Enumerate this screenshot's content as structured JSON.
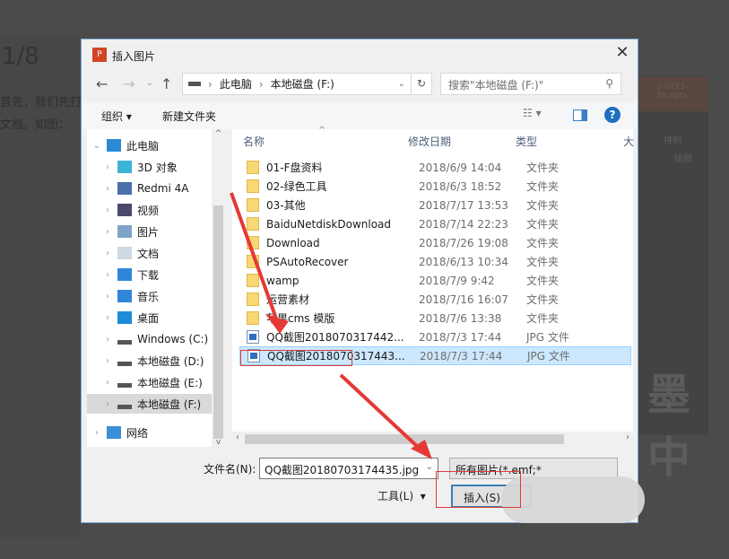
{
  "background": {
    "page_counter": "1/8",
    "line1": "首先，我们先打",
    "line2": "文档。如图：",
    "file_label": "3-0723-20.pptx",
    "ribbon_label1": "排列",
    "ribbon_label2": "绘图",
    "big_text": "墨中"
  },
  "dialog": {
    "title": "插入图片",
    "app_icon": "powerpoint-icon",
    "address": {
      "root": "此电脑",
      "current": "本地磁盘 (F:)"
    },
    "search_placeholder": "搜索\"本地磁盘 (F:)\"",
    "toolbar": {
      "organize": "组织 ▾",
      "new_folder": "新建文件夹"
    },
    "sidebar": [
      {
        "label": "此电脑",
        "icon": "computer-icon",
        "expanded": true
      },
      {
        "label": "3D 对象",
        "icon": "cube-icon"
      },
      {
        "label": "Redmi 4A",
        "icon": "phone-icon"
      },
      {
        "label": "视频",
        "icon": "video-icon"
      },
      {
        "label": "图片",
        "icon": "pictures-icon"
      },
      {
        "label": "文档",
        "icon": "document-icon"
      },
      {
        "label": "下载",
        "icon": "download-icon"
      },
      {
        "label": "音乐",
        "icon": "music-icon"
      },
      {
        "label": "桌面",
        "icon": "desktop-icon"
      },
      {
        "label": "Windows (C:)",
        "icon": "drive-icon"
      },
      {
        "label": "本地磁盘 (D:)",
        "icon": "drive-icon"
      },
      {
        "label": "本地磁盘 (E:)",
        "icon": "drive-icon"
      },
      {
        "label": "本地磁盘 (F:)",
        "icon": "drive-icon",
        "selected": true
      },
      {
        "label": "网络",
        "icon": "network-icon"
      }
    ],
    "columns": [
      "名称",
      "修改日期",
      "类型",
      "大"
    ],
    "files": [
      {
        "name": "01-F盘资料",
        "date": "2018/6/9 14:04",
        "type": "文件夹",
        "kind": "folder"
      },
      {
        "name": "02-绿色工具",
        "date": "2018/6/3 18:52",
        "type": "文件夹",
        "kind": "folder"
      },
      {
        "name": "03-其他",
        "date": "2018/7/17 13:53",
        "type": "文件夹",
        "kind": "folder"
      },
      {
        "name": "BaiduNetdiskDownload",
        "date": "2018/7/14 22:23",
        "type": "文件夹",
        "kind": "folder"
      },
      {
        "name": "Download",
        "date": "2018/7/26 19:08",
        "type": "文件夹",
        "kind": "folder"
      },
      {
        "name": "PSAutoRecover",
        "date": "2018/6/13 10:34",
        "type": "文件夹",
        "kind": "folder"
      },
      {
        "name": "wamp",
        "date": "2018/7/9 9:42",
        "type": "文件夹",
        "kind": "folder"
      },
      {
        "name": "运营素材",
        "date": "2018/7/16 16:07",
        "type": "文件夹",
        "kind": "folder"
      },
      {
        "name": "苹果cms 模版",
        "date": "2018/7/6 13:38",
        "type": "文件夹",
        "kind": "folder"
      },
      {
        "name": "QQ截图2018070317442...",
        "date": "2018/7/3 17:44",
        "type": "JPG 文件",
        "kind": "jpg"
      },
      {
        "name": "QQ截图2018070317443...",
        "date": "2018/7/3 17:44",
        "type": "JPG 文件",
        "kind": "jpg",
        "selected": true
      }
    ],
    "filename_label": "文件名(N):",
    "filename_value": "QQ截图20180703174435.jpg",
    "filter_value": "所有图片(*.emf;*",
    "tools_label": "工具(L)",
    "insert_label": "插入(S)",
    "colors": {
      "selection": "#cce8ff",
      "accent": "#3c7fb1",
      "arrow": "#e53935"
    }
  }
}
